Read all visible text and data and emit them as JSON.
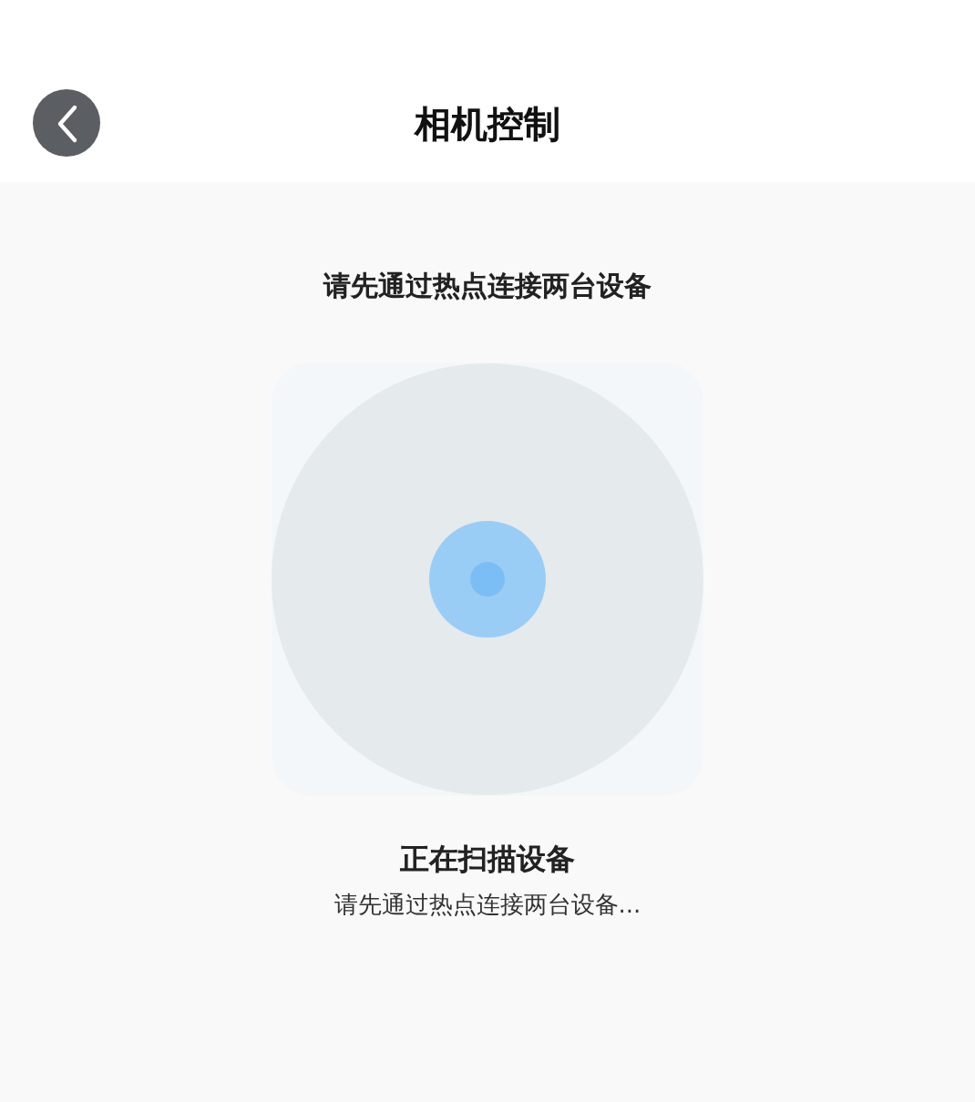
{
  "header": {
    "title": "相机控制"
  },
  "instruction": "请先通过热点连接两台设备",
  "status": {
    "title": "正在扫描设备",
    "subtitle": "请先通过热点连接两台设备..."
  }
}
